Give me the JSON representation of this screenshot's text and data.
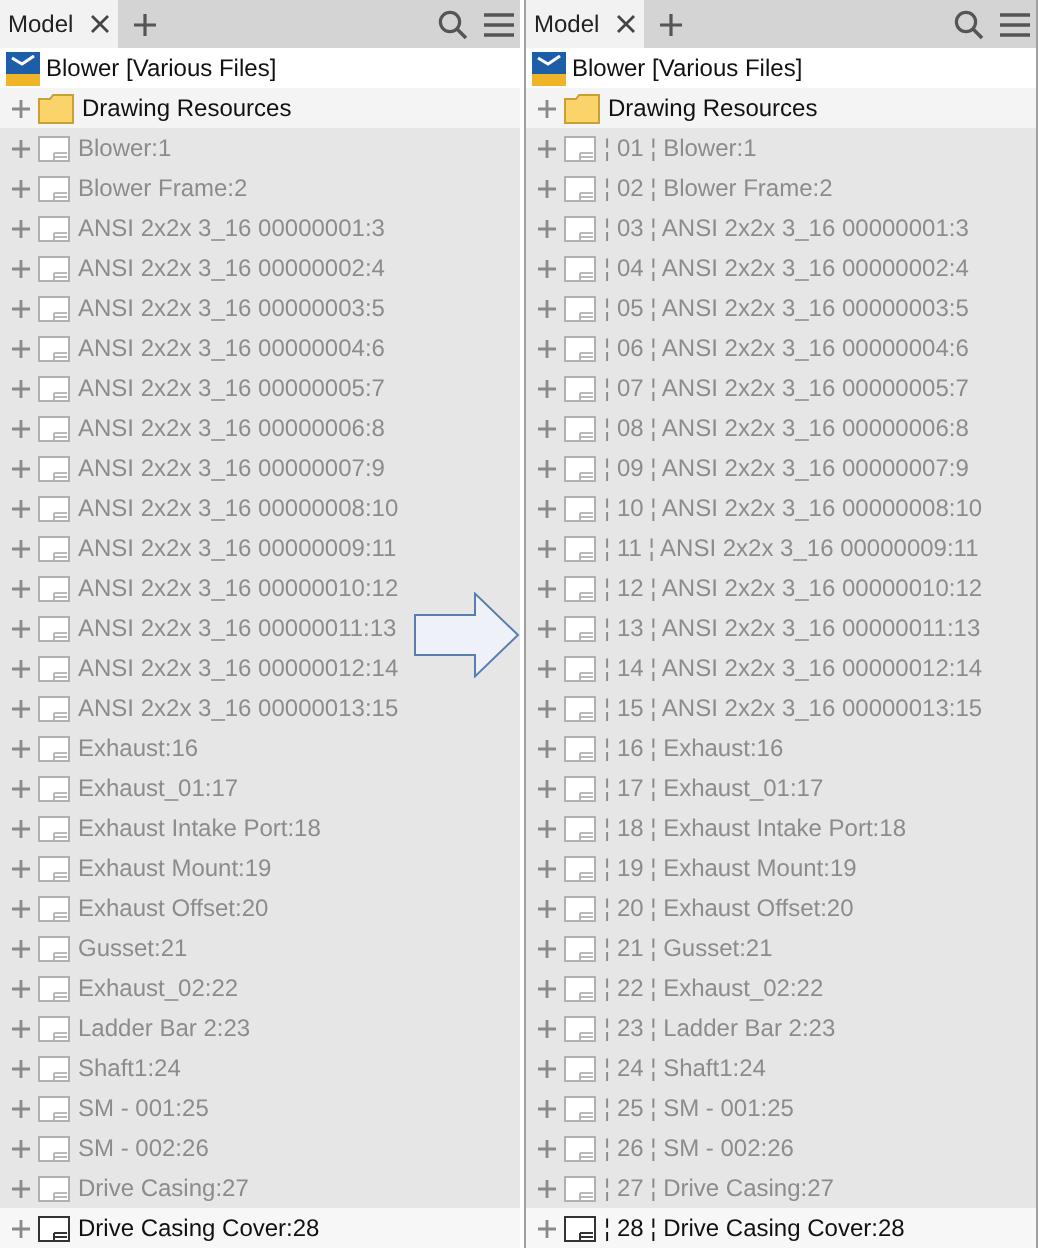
{
  "panels": [
    {
      "tab": "Model",
      "root": "Blower [Various Files]",
      "folder": "Drawing Resources",
      "items": [
        {
          "label": "Blower:1",
          "dimmed": true
        },
        {
          "label": "Blower Frame:2",
          "dimmed": true
        },
        {
          "label": "ANSI 2x2x 3_16 00000001:3",
          "dimmed": true
        },
        {
          "label": "ANSI 2x2x 3_16 00000002:4",
          "dimmed": true
        },
        {
          "label": "ANSI 2x2x 3_16 00000003:5",
          "dimmed": true
        },
        {
          "label": "ANSI 2x2x 3_16 00000004:6",
          "dimmed": true
        },
        {
          "label": "ANSI 2x2x 3_16 00000005:7",
          "dimmed": true
        },
        {
          "label": "ANSI 2x2x 3_16 00000006:8",
          "dimmed": true
        },
        {
          "label": "ANSI 2x2x 3_16 00000007:9",
          "dimmed": true
        },
        {
          "label": "ANSI 2x2x 3_16 00000008:10",
          "dimmed": true
        },
        {
          "label": "ANSI 2x2x 3_16 00000009:11",
          "dimmed": true
        },
        {
          "label": "ANSI 2x2x 3_16 00000010:12",
          "dimmed": true
        },
        {
          "label": "ANSI 2x2x 3_16 00000011:13",
          "dimmed": true
        },
        {
          "label": "ANSI 2x2x 3_16 00000012:14",
          "dimmed": true
        },
        {
          "label": "ANSI 2x2x 3_16 00000013:15",
          "dimmed": true
        },
        {
          "label": "Exhaust:16",
          "dimmed": true
        },
        {
          "label": "Exhaust_01:17",
          "dimmed": true
        },
        {
          "label": "Exhaust Intake Port:18",
          "dimmed": true
        },
        {
          "label": "Exhaust Mount:19",
          "dimmed": true
        },
        {
          "label": "Exhaust Offset:20",
          "dimmed": true
        },
        {
          "label": "Gusset:21",
          "dimmed": true
        },
        {
          "label": "Exhaust_02:22",
          "dimmed": true
        },
        {
          "label": "Ladder Bar 2:23",
          "dimmed": true
        },
        {
          "label": "Shaft1:24",
          "dimmed": true
        },
        {
          "label": "SM - 001:25",
          "dimmed": true
        },
        {
          "label": "SM - 002:26",
          "dimmed": true
        },
        {
          "label": "Drive Casing:27",
          "dimmed": true
        },
        {
          "label": "Drive Casing Cover:28",
          "dimmed": false
        }
      ]
    },
    {
      "tab": "Model",
      "root": "Blower [Various Files]",
      "folder": "Drawing Resources",
      "items": [
        {
          "label": "¦ 01 ¦ Blower:1",
          "dimmed": true
        },
        {
          "label": "¦ 02 ¦ Blower Frame:2",
          "dimmed": true
        },
        {
          "label": "¦ 03 ¦ ANSI 2x2x 3_16 00000001:3",
          "dimmed": true
        },
        {
          "label": "¦ 04 ¦ ANSI 2x2x 3_16 00000002:4",
          "dimmed": true
        },
        {
          "label": "¦ 05 ¦ ANSI 2x2x 3_16 00000003:5",
          "dimmed": true
        },
        {
          "label": "¦ 06 ¦ ANSI 2x2x 3_16 00000004:6",
          "dimmed": true
        },
        {
          "label": "¦ 07 ¦ ANSI 2x2x 3_16 00000005:7",
          "dimmed": true
        },
        {
          "label": "¦ 08 ¦ ANSI 2x2x 3_16 00000006:8",
          "dimmed": true
        },
        {
          "label": "¦ 09 ¦ ANSI 2x2x 3_16 00000007:9",
          "dimmed": true
        },
        {
          "label": "¦ 10 ¦ ANSI 2x2x 3_16 00000008:10",
          "dimmed": true
        },
        {
          "label": "¦ 11 ¦ ANSI 2x2x 3_16 00000009:11",
          "dimmed": true
        },
        {
          "label": "¦ 12 ¦ ANSI 2x2x 3_16 00000010:12",
          "dimmed": true
        },
        {
          "label": "¦ 13 ¦ ANSI 2x2x 3_16 00000011:13",
          "dimmed": true
        },
        {
          "label": "¦ 14 ¦ ANSI 2x2x 3_16 00000012:14",
          "dimmed": true
        },
        {
          "label": "¦ 15 ¦ ANSI 2x2x 3_16 00000013:15",
          "dimmed": true
        },
        {
          "label": "¦ 16 ¦ Exhaust:16",
          "dimmed": true
        },
        {
          "label": "¦ 17 ¦ Exhaust_01:17",
          "dimmed": true
        },
        {
          "label": "¦ 18 ¦ Exhaust Intake Port:18",
          "dimmed": true
        },
        {
          "label": "¦ 19 ¦ Exhaust Mount:19",
          "dimmed": true
        },
        {
          "label": "¦ 20 ¦ Exhaust Offset:20",
          "dimmed": true
        },
        {
          "label": "¦ 21 ¦ Gusset:21",
          "dimmed": true
        },
        {
          "label": "¦ 22 ¦ Exhaust_02:22",
          "dimmed": true
        },
        {
          "label": "¦ 23 ¦ Ladder Bar 2:23",
          "dimmed": true
        },
        {
          "label": "¦ 24 ¦ Shaft1:24",
          "dimmed": true
        },
        {
          "label": "¦ 25 ¦ SM - 001:25",
          "dimmed": true
        },
        {
          "label": "¦ 26 ¦ SM - 002:26",
          "dimmed": true
        },
        {
          "label": "¦ 27 ¦ Drive Casing:27",
          "dimmed": true
        },
        {
          "label": "¦ 28 ¦ Drive Casing Cover:28",
          "dimmed": false
        }
      ]
    }
  ]
}
